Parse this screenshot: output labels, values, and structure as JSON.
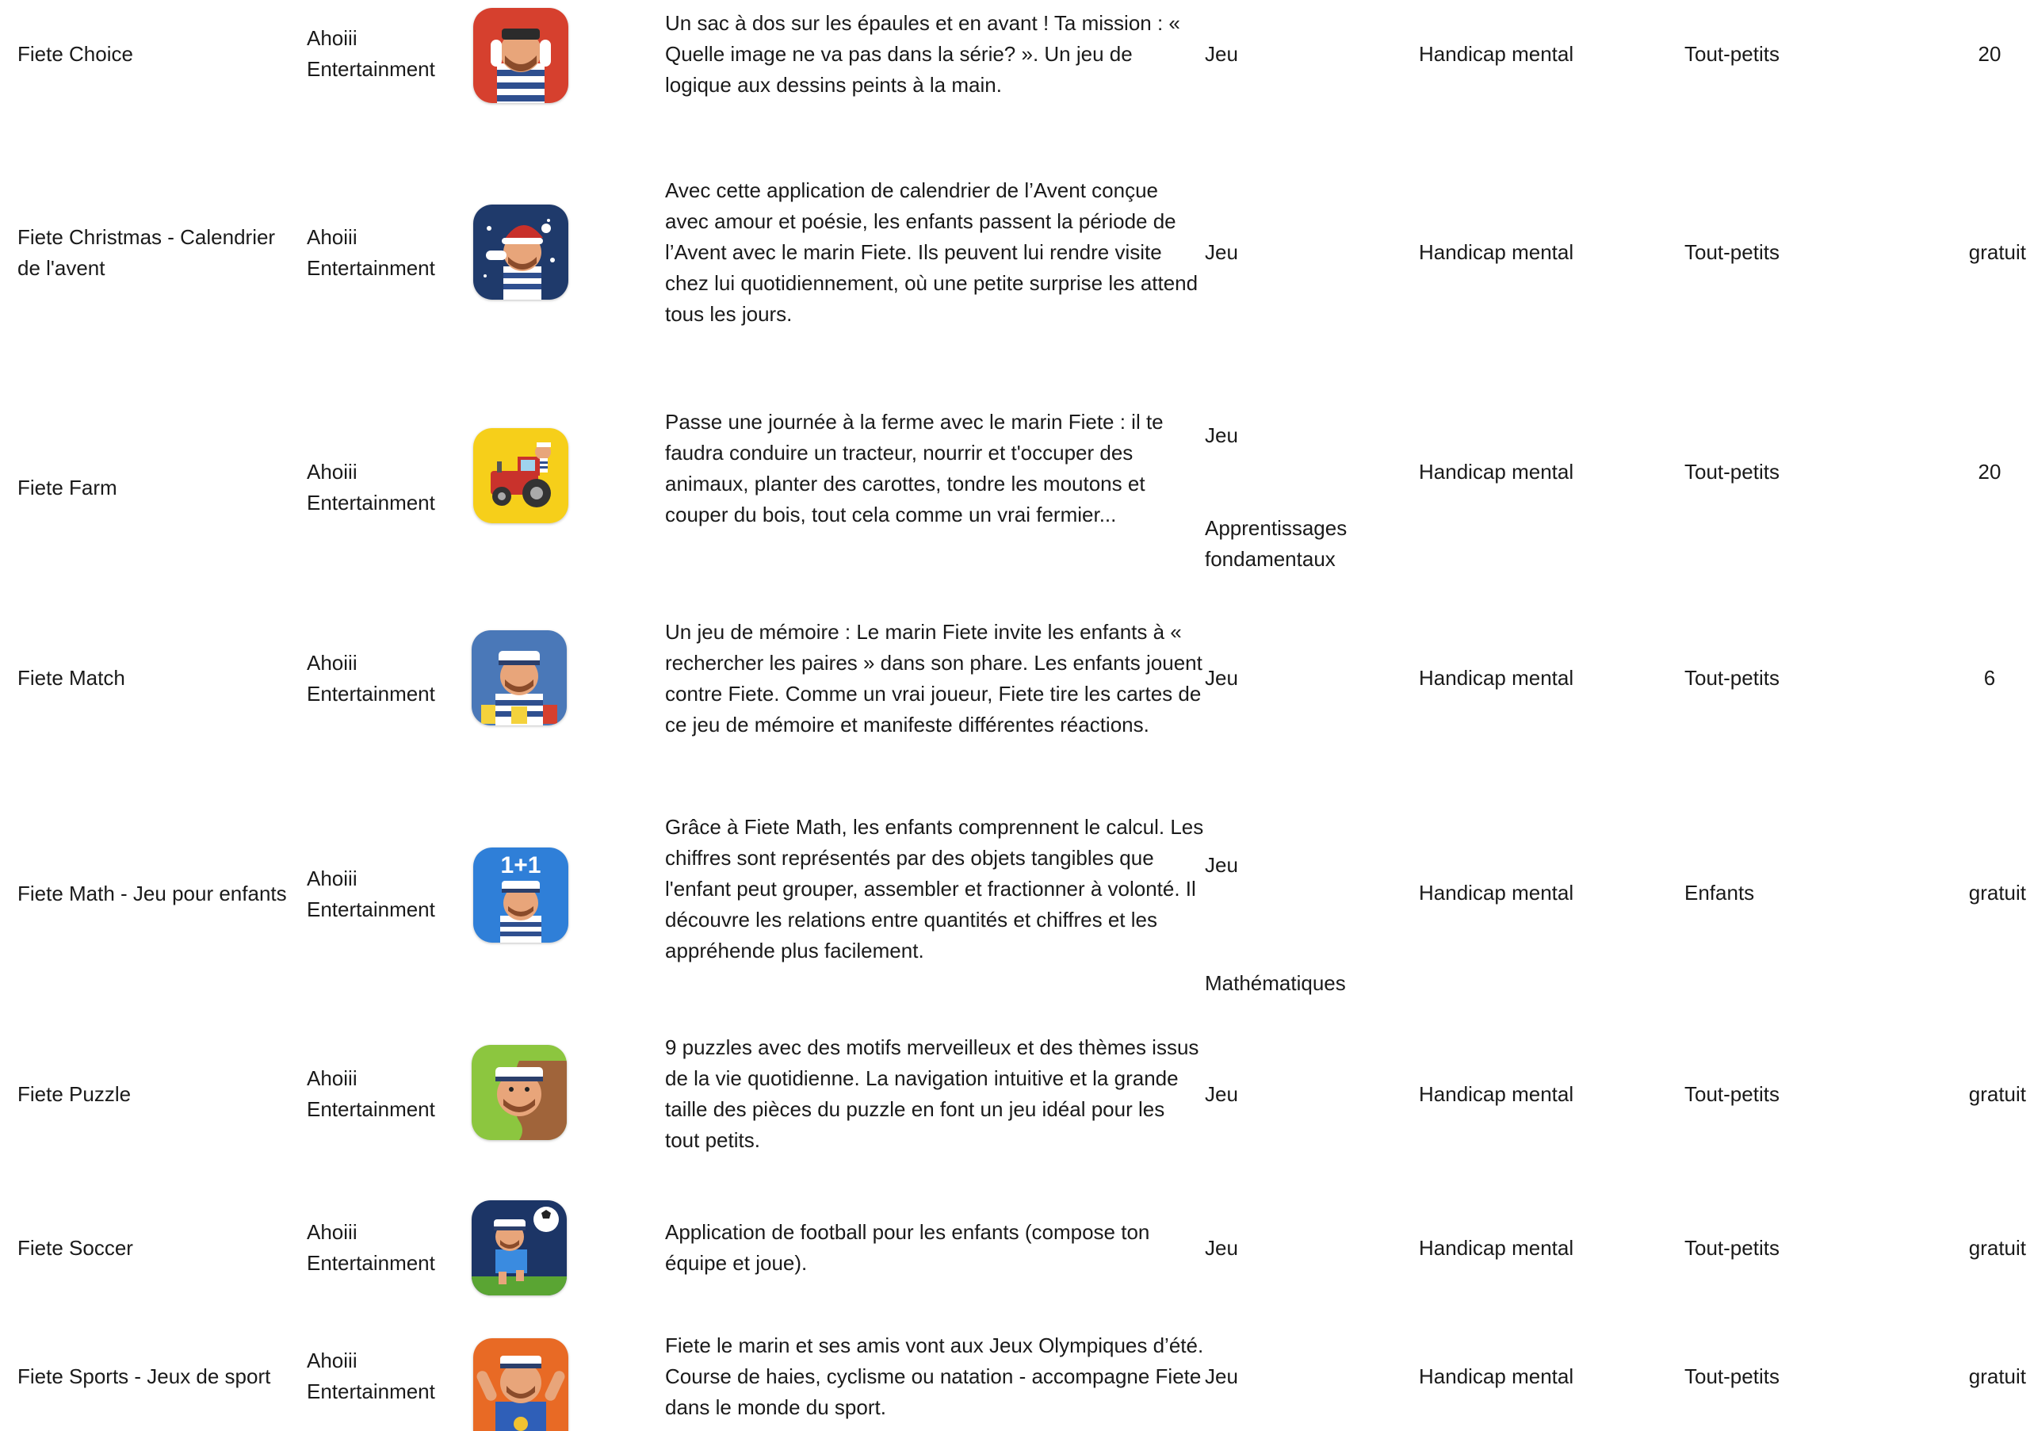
{
  "rows": [
    {
      "name": "Fiete Choice",
      "developer": "Ahoiii Entertainment",
      "icon": "fiete-choice-icon",
      "description": "Un sac à dos sur les épaules et en avant ! Ta mission : « Quelle image ne va pas dans la série? ». Un jeu de logique aux dessins peints à la main.",
      "categories": [
        "Jeu"
      ],
      "handicap": "Handicap mental",
      "age": "Tout-petits",
      "price": "20"
    },
    {
      "name": "Fiete Christmas - Calendrier de l'avent",
      "developer": "Ahoiii Entertainment",
      "icon": "fiete-christmas-icon",
      "description": "Avec cette application de calendrier de l’Avent conçue avec amour et poésie, les enfants passent la période de l’Avent avec le marin Fiete. Ils peuvent lui rendre visite chez lui quotidiennement, où une petite surprise les attend tous les jours.",
      "categories": [
        "Jeu"
      ],
      "handicap": "Handicap mental",
      "age": "Tout-petits",
      "price": "gratuit"
    },
    {
      "name": "Fiete Farm",
      "developer": "Ahoiii Entertainment",
      "icon": "fiete-farm-icon",
      "description": "Passe une journée à la ferme avec le marin Fiete : il te faudra conduire un tracteur, nourrir et t'occuper des animaux, planter des carottes, tondre les moutons et couper du bois, tout cela comme un vrai fermier...",
      "categories": [
        "Jeu",
        "Apprentissages fondamentaux"
      ],
      "handicap": "Handicap mental",
      "age": "Tout-petits",
      "price": "20"
    },
    {
      "name": "Fiete Match",
      "developer": "Ahoiii Entertainment",
      "icon": "fiete-match-icon",
      "description": "Un jeu de mémoire : Le marin Fiete invite les enfants à « rechercher les paires » dans son phare. Les enfants jouent contre Fiete. Comme un vrai joueur, Fiete tire les cartes de ce jeu de mémoire et manifeste différentes réactions.",
      "categories": [
        "Jeu"
      ],
      "handicap": "Handicap mental",
      "age": "Tout-petits",
      "price": "6"
    },
    {
      "name": "Fiete Math - Jeu pour enfants",
      "developer": "Ahoiii Entertainment",
      "icon": "fiete-math-icon",
      "icon_text": "1+1",
      "description": "Grâce à Fiete Math, les enfants comprennent le calcul. Les chiffres sont représentés par des objets tangibles que l'enfant peut grouper, assembler et fractionner à volonté. Il découvre les relations entre quantités et chiffres et les appréhende plus facilement.",
      "categories": [
        "Jeu",
        "Mathématiques"
      ],
      "handicap": "Handicap mental",
      "age": "Enfants",
      "price": "gratuit"
    },
    {
      "name": "Fiete Puzzle",
      "developer": "Ahoiii Entertainment",
      "icon": "fiete-puzzle-icon",
      "description": "9 puzzles avec des motifs merveilleux et des thèmes issus de la vie quotidienne. La navigation intuitive et la grande taille des pièces du puzzle en font un jeu idéal pour les tout petits.",
      "categories": [
        "Jeu"
      ],
      "handicap": "Handicap mental",
      "age": "Tout-petits",
      "price": "gratuit"
    },
    {
      "name": "Fiete Soccer",
      "developer": "Ahoiii Entertainment",
      "icon": "fiete-soccer-icon",
      "description": "Application de football pour les enfants (compose ton équipe et joue).",
      "categories": [
        "Jeu"
      ],
      "handicap": "Handicap mental",
      "age": "Tout-petits",
      "price": "gratuit"
    },
    {
      "name": "Fiete Sports - Jeux de sport",
      "developer": "Ahoiii Entertainment",
      "icon": "fiete-sports-icon",
      "description": "Fiete le marin et ses amis vont aux Jeux Olympiques d’été. Course de haies, cyclisme ou natation - accompagne Fiete dans le monde du sport.",
      "categories": [
        "Jeu"
      ],
      "handicap": "Handicap mental",
      "age": "Tout-petits",
      "price": "gratuit"
    }
  ]
}
